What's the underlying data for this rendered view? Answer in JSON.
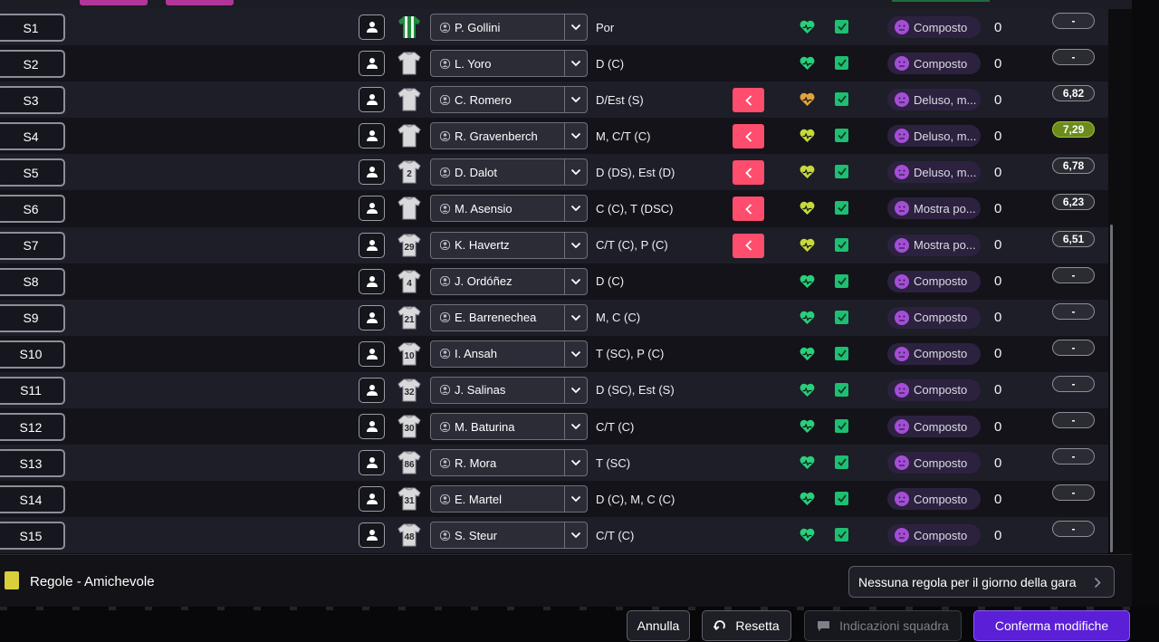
{
  "rows": [
    {
      "slot": "S1",
      "name": "P. Gollini",
      "pos": "Por",
      "shirt": "green",
      "shirt_no": "",
      "back": false,
      "heart": "green",
      "morale": "Composto",
      "count": "0",
      "rating": "-",
      "rating_style": "plain"
    },
    {
      "slot": "S2",
      "name": "L. Yoro",
      "pos": "D (C)",
      "shirt": "white",
      "shirt_no": "",
      "back": false,
      "heart": "green",
      "morale": "Composto",
      "count": "0",
      "rating": "-",
      "rating_style": "plain"
    },
    {
      "slot": "S3",
      "name": "C. Romero",
      "pos": "D/Est (S)",
      "shirt": "white",
      "shirt_no": "",
      "back": true,
      "heart": "orange",
      "morale": "Deluso, m...",
      "count": "0",
      "rating": "6,82",
      "rating_style": "plain"
    },
    {
      "slot": "S4",
      "name": "R. Gravenberch",
      "pos": "M, C/T (C)",
      "shirt": "white",
      "shirt_no": "",
      "back": true,
      "heart": "yellow",
      "morale": "Deluso, m...",
      "count": "0",
      "rating": "7,29",
      "rating_style": "green"
    },
    {
      "slot": "S5",
      "name": "D. Dalot",
      "pos": "D (DS), Est (D)",
      "shirt": "white",
      "shirt_no": "2",
      "back": true,
      "heart": "yellow",
      "morale": "Deluso, m...",
      "count": "0",
      "rating": "6,78",
      "rating_style": "plain"
    },
    {
      "slot": "S6",
      "name": "M. Asensio",
      "pos": "C (C), T (DSC)",
      "shirt": "white",
      "shirt_no": "",
      "back": true,
      "heart": "yellow",
      "morale": "Mostra po...",
      "count": "0",
      "rating": "6,23",
      "rating_style": "plain"
    },
    {
      "slot": "S7",
      "name": "K. Havertz",
      "pos": "C/T (C), P (C)",
      "shirt": "white",
      "shirt_no": "29",
      "back": true,
      "heart": "yellow",
      "morale": "Mostra po...",
      "count": "0",
      "rating": "6,51",
      "rating_style": "plain"
    },
    {
      "slot": "S8",
      "name": "J. Ordóñez",
      "pos": "D (C)",
      "shirt": "white",
      "shirt_no": "4",
      "back": false,
      "heart": "green",
      "morale": "Composto",
      "count": "0",
      "rating": "-",
      "rating_style": "plain"
    },
    {
      "slot": "S9",
      "name": "E. Barrenechea",
      "pos": "M, C (C)",
      "shirt": "white",
      "shirt_no": "21",
      "back": false,
      "heart": "green",
      "morale": "Composto",
      "count": "0",
      "rating": "-",
      "rating_style": "plain"
    },
    {
      "slot": "S10",
      "name": "I. Ansah",
      "pos": "T (SC), P (C)",
      "shirt": "white",
      "shirt_no": "10",
      "back": false,
      "heart": "green",
      "morale": "Composto",
      "count": "0",
      "rating": "-",
      "rating_style": "plain"
    },
    {
      "slot": "S11",
      "name": "J. Salinas",
      "pos": "D (SC), Est (S)",
      "shirt": "white",
      "shirt_no": "32",
      "back": false,
      "heart": "green",
      "morale": "Composto",
      "count": "0",
      "rating": "-",
      "rating_style": "plain"
    },
    {
      "slot": "S12",
      "name": "M. Baturina",
      "pos": "C/T (C)",
      "shirt": "white",
      "shirt_no": "30",
      "back": false,
      "heart": "green",
      "morale": "Composto",
      "count": "0",
      "rating": "-",
      "rating_style": "plain"
    },
    {
      "slot": "S13",
      "name": "R. Mora",
      "pos": "T (SC)",
      "shirt": "white",
      "shirt_no": "86",
      "back": false,
      "heart": "green",
      "morale": "Composto",
      "count": "0",
      "rating": "-",
      "rating_style": "plain"
    },
    {
      "slot": "S14",
      "name": "E. Martel",
      "pos": "D (C), M, C (C)",
      "shirt": "white",
      "shirt_no": "31",
      "back": false,
      "heart": "green",
      "morale": "Composto",
      "count": "0",
      "rating": "-",
      "rating_style": "plain"
    },
    {
      "slot": "S15",
      "name": "S. Steur",
      "pos": "C/T (C)",
      "shirt": "white",
      "shirt_no": "48",
      "back": false,
      "heart": "green",
      "morale": "Composto",
      "count": "0",
      "rating": "-",
      "rating_style": "plain"
    }
  ],
  "rules": {
    "label": "Regole - Amichevole",
    "match_day_button": "Nessuna regola per il giorno della gara"
  },
  "footer": {
    "cancel": "Annulla",
    "reset": "Resetta",
    "team_talk": "Indicazioni squadra",
    "confirm": "Conferma modifiche"
  },
  "colors": {
    "heart_green": "#27d07a",
    "heart_yellow": "#c7d93a",
    "heart_orange": "#e2a23a",
    "back_button": "#ff4d6d",
    "check": "#1dbf73",
    "confirm": "#5a1fd6"
  },
  "icons": {
    "player_profile": "person-icon",
    "dropdown": "chevron-down-icon",
    "back": "chevron-left-icon",
    "condition": "heart-icon",
    "selected": "checkbox-icon",
    "morale": "face-icon",
    "reset": "undo-icon",
    "team_talk": "speech-bubble-icon"
  }
}
